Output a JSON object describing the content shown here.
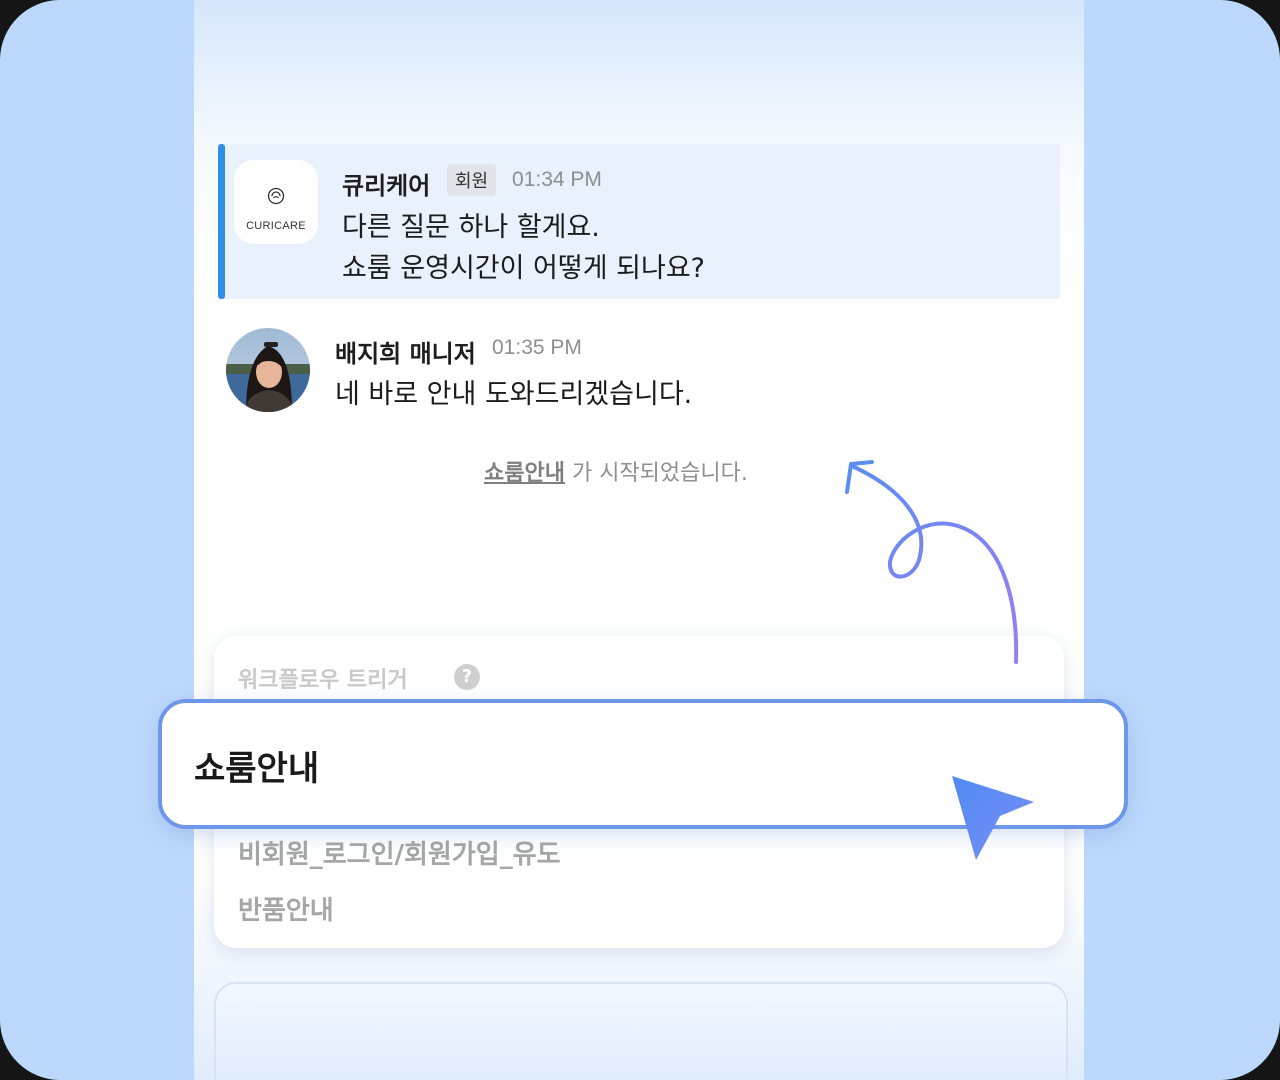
{
  "chat": {
    "message1": {
      "avatar_logo_text": "CURICARE",
      "sender": "큐리케어",
      "badge": "회원",
      "time": "01:34 PM",
      "line1": "다른 질문 하나 할게요.",
      "line2": "쇼룸 운영시간이 어떻게 되나요?"
    },
    "message2": {
      "sender": "배지희 매니저",
      "time": "01:35 PM",
      "line1": "네 바로 안내 도와드리겠습니다."
    },
    "system": {
      "link": "쇼룸안내",
      "suffix": " 가 시작되었습니다."
    }
  },
  "workflow": {
    "label": "워크플로우 트리거",
    "help_icon": "?",
    "selected": "쇼룸안내",
    "options": [
      "비회원_로그인/회원가입_유도",
      "반품안내"
    ]
  },
  "colors": {
    "frame_bg": "#bcd8fc",
    "highlight_bar": "#2f8ee6",
    "selected_border": "#6d98ea",
    "arrow_start": "#5b8ef0",
    "arrow_end": "#9b7ef3"
  },
  "icons": [
    "curicare-logo-icon",
    "help-icon",
    "curved-arrow-icon",
    "cursor-pointer-icon"
  ]
}
